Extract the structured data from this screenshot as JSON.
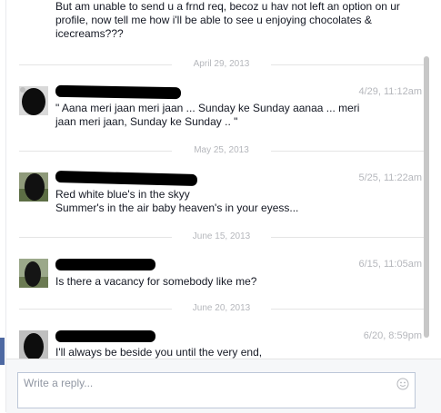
{
  "thread": {
    "top_message": "But am unable to send  u a frnd req, becoz u hav not left an option on ur profile, now tell me how i'll be able to see u enjoying chocolates & icecreams???",
    "items": [
      {
        "date": "April 29, 2013",
        "time": "4/29, 11:12am",
        "lines": [
          " \" Aana meri jaan meri jaan ... Sunday ke Sunday aanaa ... meri",
          "jaan meri jaan, Sunday ke Sunday .. \""
        ]
      },
      {
        "date": "May 25, 2013",
        "time": "5/25, 11:22am",
        "lines": [
          " Red white blue's in the skyy",
          "Summer's in the air baby heaven's in your eyess..."
        ]
      },
      {
        "date": "June 15, 2013",
        "time": "6/15, 11:05am",
        "lines": [
          "Is there a vacancy for somebody like me?"
        ]
      },
      {
        "date": "June 20, 2013",
        "time": "6/20, 8:59pm",
        "lines": [
          "I'll always be beside you until the very end,"
        ]
      }
    ]
  },
  "composer": {
    "placeholder": "Write a reply...",
    "emoji_icon": "smiley-icon"
  },
  "colors": {
    "timestamp": "#b5b7bc",
    "text": "#141823",
    "composer_border": "#bdc7d8",
    "scrollbar": "#c7c7c7"
  }
}
